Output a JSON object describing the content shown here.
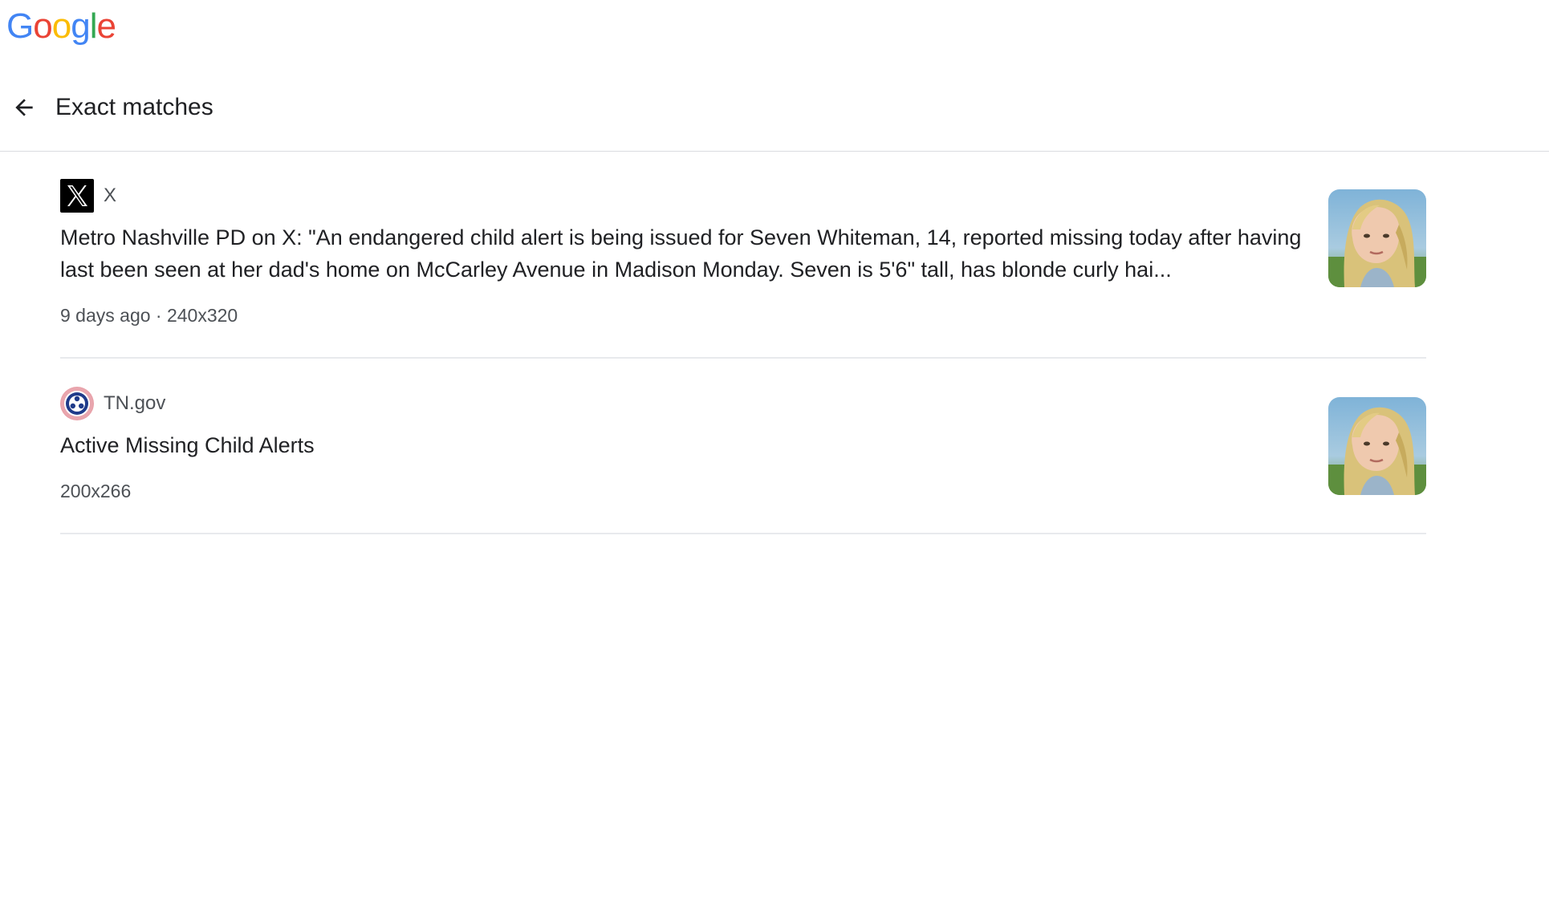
{
  "logo": {
    "text": "Google",
    "letters": [
      {
        "char": "G",
        "color": "#4285F4"
      },
      {
        "char": "o",
        "color": "#EA4335"
      },
      {
        "char": "o",
        "color": "#FBBC05"
      },
      {
        "char": "g",
        "color": "#4285F4"
      },
      {
        "char": "l",
        "color": "#34A853"
      },
      {
        "char": "e",
        "color": "#EA4335"
      }
    ]
  },
  "header": {
    "back_icon": "arrow-left-icon",
    "title": "Exact matches"
  },
  "results": [
    {
      "favicon": "x-logo-icon",
      "source": "X",
      "title": "Metro Nashville PD on X: \"An endangered child alert is being issued for Seven Whiteman, 14, reported missing today after having last been seen at her dad's home on McCarley Avenue in Madison Monday. Seven is 5'6\" tall, has blonde curly hai...",
      "meta": "9 days ago · 240x320",
      "thumbnail": "portrait-photo"
    },
    {
      "favicon": "tennessee-seal-icon",
      "source": "TN.gov",
      "title": "Active Missing Child Alerts",
      "meta": "200x266",
      "thumbnail": "portrait-photo"
    }
  ],
  "colors": {
    "divider": "#dadce0",
    "meta_text": "#4d5156",
    "title_text": "#202124"
  }
}
